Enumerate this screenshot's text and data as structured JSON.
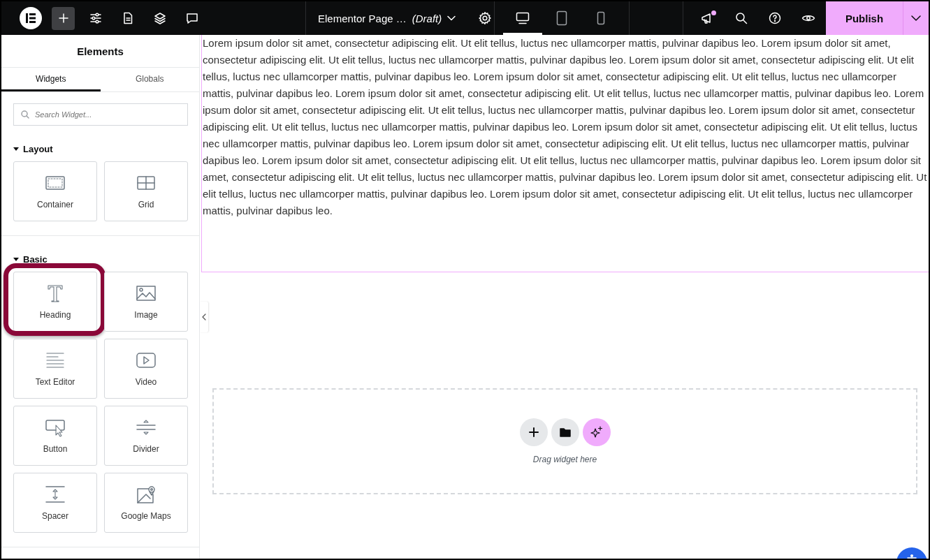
{
  "topbar": {
    "tools": [
      {
        "kind": "add",
        "selected": true
      },
      {
        "kind": "settings"
      },
      {
        "kind": "page"
      },
      {
        "kind": "layers"
      },
      {
        "kind": "comments"
      }
    ],
    "document": {
      "title": "Elementor Page …",
      "status": "(Draft)"
    },
    "devices": [
      {
        "kind": "desktop",
        "selected": true
      },
      {
        "kind": "tablet",
        "selected": false
      },
      {
        "kind": "mobile",
        "selected": false
      }
    ],
    "actions": [
      {
        "kind": "whats-new",
        "notification": true
      },
      {
        "kind": "search",
        "notification": false
      },
      {
        "kind": "help",
        "notification": false
      },
      {
        "kind": "preview",
        "notification": false
      }
    ],
    "publish": {
      "label": "Publish"
    }
  },
  "panel": {
    "title": "Elements",
    "tabs": [
      {
        "label": "Widgets",
        "selected": true
      },
      {
        "label": "Globals",
        "selected": false
      }
    ],
    "search": {
      "placeholder": "Search Widget..."
    },
    "categories": [
      {
        "title": "Layout",
        "expanded": true,
        "widgets": [
          {
            "label": "Container",
            "kind": "container",
            "highlighted": false
          },
          {
            "label": "Grid",
            "kind": "grid",
            "highlighted": false
          }
        ]
      },
      {
        "title": "Basic",
        "expanded": true,
        "widgets": [
          {
            "label": "Heading",
            "kind": "heading",
            "highlighted": true
          },
          {
            "label": "Image",
            "kind": "image",
            "highlighted": false
          },
          {
            "label": "Text Editor",
            "kind": "text",
            "highlighted": false
          },
          {
            "label": "Video",
            "kind": "video",
            "highlighted": false
          },
          {
            "label": "Button",
            "kind": "button",
            "highlighted": false
          },
          {
            "label": "Divider",
            "kind": "divider",
            "highlighted": false
          },
          {
            "label": "Spacer",
            "kind": "spacer",
            "highlighted": false
          },
          {
            "label": "Google Maps",
            "kind": "maps",
            "highlighted": false
          }
        ]
      }
    ]
  },
  "canvas": {
    "text": "Lorem ipsum dolor sit amet, consectetur adipiscing elit. Ut elit tellus, luctus nec ullamcorper mattis, pulvinar dapibus leo. Lorem ipsum dolor sit amet, consectetur adipiscing elit. Ut elit tellus, luctus nec ullamcorper mattis, pulvinar dapibus leo. Lorem ipsum dolor sit amet, consectetur adipiscing elit. Ut elit tellus, luctus nec ullamcorper mattis, pulvinar dapibus leo. Lorem ipsum dolor sit amet, consectetur adipiscing elit. Ut elit tellus, luctus nec ullamcorper mattis, pulvinar dapibus leo. Lorem ipsum dolor sit amet, consectetur adipiscing elit. Ut elit tellus, luctus nec ullamcorper mattis, pulvinar dapibus leo. Lorem ipsum dolor sit amet, consectetur adipiscing elit. Ut elit tellus, luctus nec ullamcorper mattis, pulvinar dapibus leo. Lorem ipsum dolor sit amet, consectetur adipiscing elit. Ut elit tellus, luctus nec ullamcorper mattis, pulvinar dapibus leo. Lorem ipsum dolor sit amet, consectetur adipiscing elit. Ut elit tellus, luctus nec ullamcorper mattis, pulvinar dapibus leo. Lorem ipsum dolor sit amet, consectetur adipiscing elit. Ut elit tellus, luctus nec ullamcorper mattis, pulvinar dapibus leo. Lorem ipsum dolor sit amet, consectetur adipiscing elit. Ut elit tellus, luctus nec ullamcorper mattis, pulvinar dapibus leo. Lorem ipsum dolor sit amet, consectetur adipiscing elit. Ut elit tellus, luctus nec ullamcorper mattis, pulvinar dapibus leo. Lorem ipsum dolor sit amet, consectetur adipiscing elit. Ut elit tellus, luctus nec ullamcorper mattis, pulvinar dapibus leo. Lorem ipsum dolor sit amet, consectetur adipiscing elit. Ut elit tellus, luctus nec ullamcorper mattis, pulvinar dapibus leo.",
    "dropzone": {
      "buttons": [
        {
          "kind": "add"
        },
        {
          "kind": "template"
        },
        {
          "kind": "ai"
        }
      ],
      "hint": "Drag widget here"
    }
  }
}
